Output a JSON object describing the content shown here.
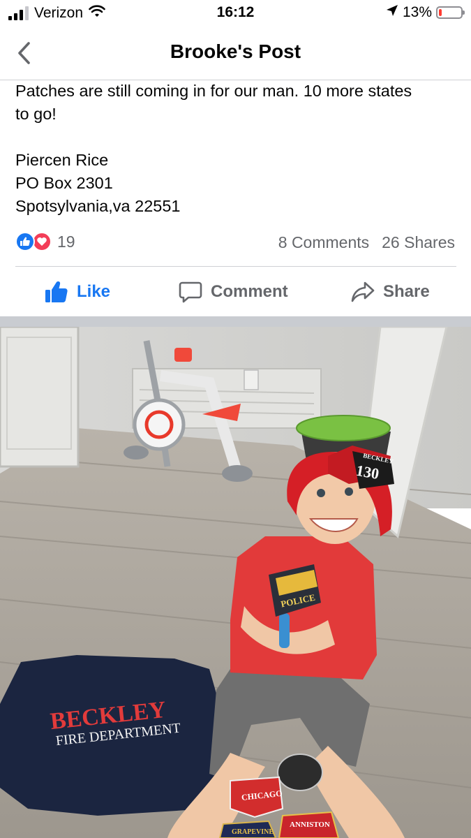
{
  "status_bar": {
    "carrier": "Verizon",
    "time": "16:12",
    "battery_percent": "13%",
    "battery_level": 0.13,
    "signal_bars": 3,
    "icons": [
      "signal-icon",
      "wifi-icon",
      "location-arrow-icon",
      "battery-icon"
    ]
  },
  "nav": {
    "title": "Brooke's Post",
    "back_icon": "chevron-left-icon"
  },
  "post": {
    "lines": [
      "Patches are still coming in for our man. 10 more states",
      "to go!",
      "",
      "Piercen Rice",
      "PO Box 2301",
      "Spotsylvania,va 22551"
    ]
  },
  "stats": {
    "reactions": [
      "like-reaction-icon",
      "love-reaction-icon"
    ],
    "reaction_count": "19",
    "comments": "8 Comments",
    "shares": "26 Shares"
  },
  "actions": {
    "like": "Like",
    "comment": "Comment",
    "share": "Share"
  },
  "photo": {
    "helmet_number": "130",
    "helmet_banner": "BECKLEY",
    "shirt_title": "BECKLEY",
    "shirt_subtitle": "FIRE DEPARTMENT",
    "patch_police": "POLICE",
    "patch_chicago": "CHICAGO",
    "patch_anniston": "ANNISTON",
    "patch_grapevine": "GRAPEVINE",
    "colors": {
      "accent_blue": "#1877f2",
      "love_red": "#f33e58",
      "helmet_red": "#d51f26",
      "shirt_navy": "#1b2540"
    }
  }
}
